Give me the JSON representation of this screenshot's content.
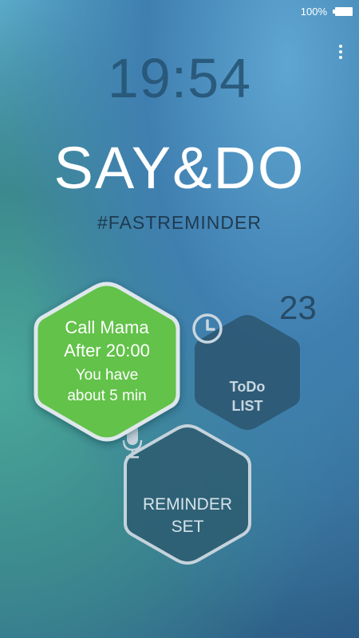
{
  "status_bar": {
    "battery_percent": "100%"
  },
  "clock": {
    "time": "19:54"
  },
  "app": {
    "title": "SAY&DO",
    "subtitle": "#FASTREMINDER"
  },
  "todo": {
    "count": "23",
    "label_line1": "ToDo",
    "label_line2": "LIST"
  },
  "reminder": {
    "title": "Call Mama",
    "time": "After 20:00",
    "note_line1": "You have",
    "note_line2": "about 5 min"
  },
  "set_button": {
    "label_line1": "REMINDER",
    "label_line2": "SET"
  },
  "icons": [
    "battery-icon",
    "overflow-menu-icon",
    "clock-icon",
    "microphone-icon"
  ],
  "colors": {
    "reminder_fill": "#62c24a",
    "reminder_border": "#dfe7ec",
    "todo_fill": "#2c5671",
    "set_fill": "#2f5e73"
  }
}
